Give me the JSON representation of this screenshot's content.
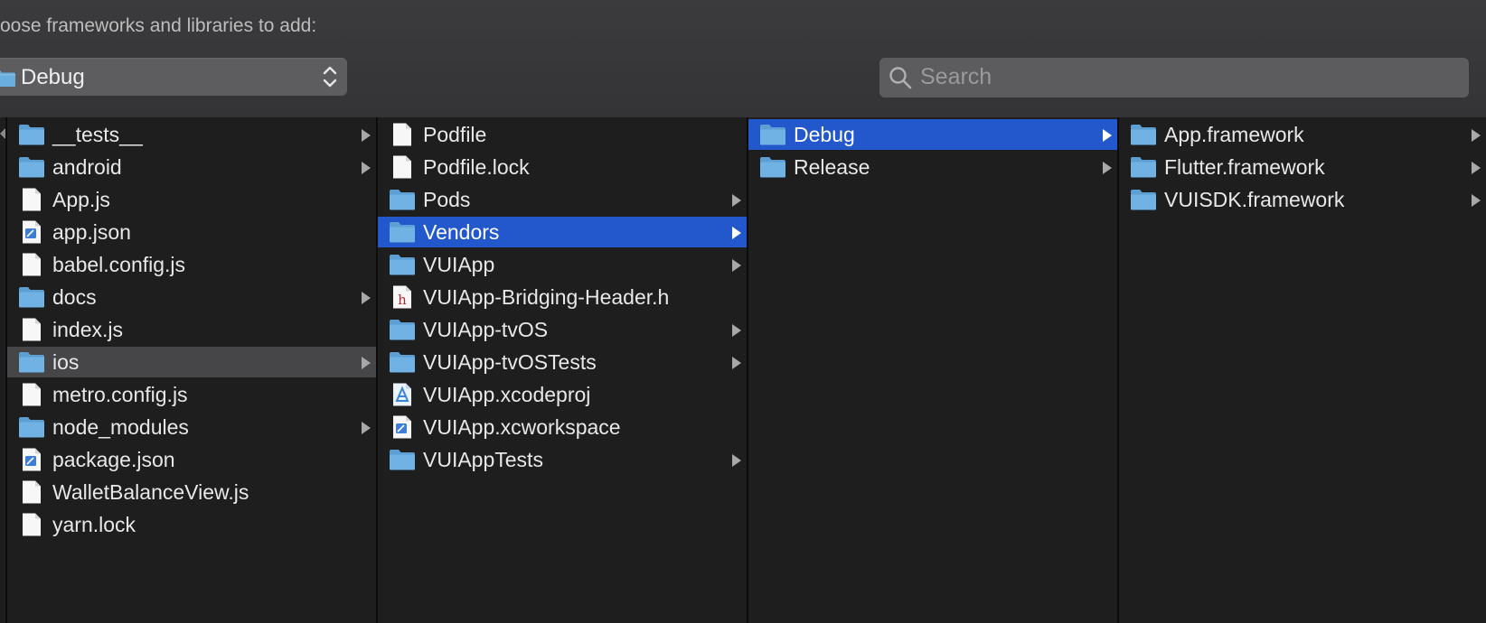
{
  "dialog": {
    "prompt": "oose frameworks and libraries to add:",
    "location_popup": {
      "value": "Debug"
    },
    "search": {
      "placeholder": "Search",
      "value": ""
    }
  },
  "columns": [
    {
      "items": [
        {
          "label": "__tests__",
          "icon": "folder-icon",
          "has_children": true,
          "selected": ""
        },
        {
          "label": "android",
          "icon": "folder-icon",
          "has_children": true,
          "selected": ""
        },
        {
          "label": "App.js",
          "icon": "document-icon",
          "has_children": false,
          "selected": ""
        },
        {
          "label": "app.json",
          "icon": "json-file-icon",
          "has_children": false,
          "selected": ""
        },
        {
          "label": "babel.config.js",
          "icon": "document-icon",
          "has_children": false,
          "selected": ""
        },
        {
          "label": "docs",
          "icon": "folder-icon",
          "has_children": true,
          "selected": ""
        },
        {
          "label": "index.js",
          "icon": "document-icon",
          "has_children": false,
          "selected": ""
        },
        {
          "label": "ios",
          "icon": "folder-icon",
          "has_children": true,
          "selected": "inactive"
        },
        {
          "label": "metro.config.js",
          "icon": "document-icon",
          "has_children": false,
          "selected": ""
        },
        {
          "label": "node_modules",
          "icon": "folder-icon",
          "has_children": true,
          "selected": ""
        },
        {
          "label": "package.json",
          "icon": "json-file-icon",
          "has_children": false,
          "selected": ""
        },
        {
          "label": "WalletBalanceView.js",
          "icon": "document-icon",
          "has_children": false,
          "selected": ""
        },
        {
          "label": "yarn.lock",
          "icon": "document-icon",
          "has_children": false,
          "selected": ""
        }
      ]
    },
    {
      "items": [
        {
          "label": "Podfile",
          "icon": "document-icon",
          "has_children": false,
          "selected": ""
        },
        {
          "label": "Podfile.lock",
          "icon": "document-icon",
          "has_children": false,
          "selected": ""
        },
        {
          "label": "Pods",
          "icon": "folder-icon",
          "has_children": true,
          "selected": ""
        },
        {
          "label": "Vendors",
          "icon": "folder-icon",
          "has_children": true,
          "selected": "active"
        },
        {
          "label": "VUIApp",
          "icon": "folder-icon",
          "has_children": true,
          "selected": ""
        },
        {
          "label": "VUIApp-Bridging-Header.h",
          "icon": "header-file-icon",
          "has_children": false,
          "selected": ""
        },
        {
          "label": "VUIApp-tvOS",
          "icon": "folder-icon",
          "has_children": true,
          "selected": ""
        },
        {
          "label": "VUIApp-tvOSTests",
          "icon": "folder-icon",
          "has_children": true,
          "selected": ""
        },
        {
          "label": "VUIApp.xcodeproj",
          "icon": "xcodeproj-icon",
          "has_children": false,
          "selected": ""
        },
        {
          "label": "VUIApp.xcworkspace",
          "icon": "xcworkspace-icon",
          "has_children": false,
          "selected": ""
        },
        {
          "label": "VUIAppTests",
          "icon": "folder-icon",
          "has_children": true,
          "selected": ""
        }
      ]
    },
    {
      "items": [
        {
          "label": "Debug",
          "icon": "folder-icon",
          "has_children": true,
          "selected": "active"
        },
        {
          "label": "Release",
          "icon": "folder-icon",
          "has_children": true,
          "selected": ""
        }
      ]
    },
    {
      "items": [
        {
          "label": "App.framework",
          "icon": "folder-icon",
          "has_children": true,
          "selected": ""
        },
        {
          "label": "Flutter.framework",
          "icon": "folder-icon",
          "has_children": true,
          "selected": ""
        },
        {
          "label": "VUISDK.framework",
          "icon": "folder-icon",
          "has_children": true,
          "selected": ""
        }
      ]
    }
  ],
  "colors": {
    "selection_active": "#2258cc",
    "selection_inactive": "#464648",
    "folder": "#6aaee0"
  }
}
